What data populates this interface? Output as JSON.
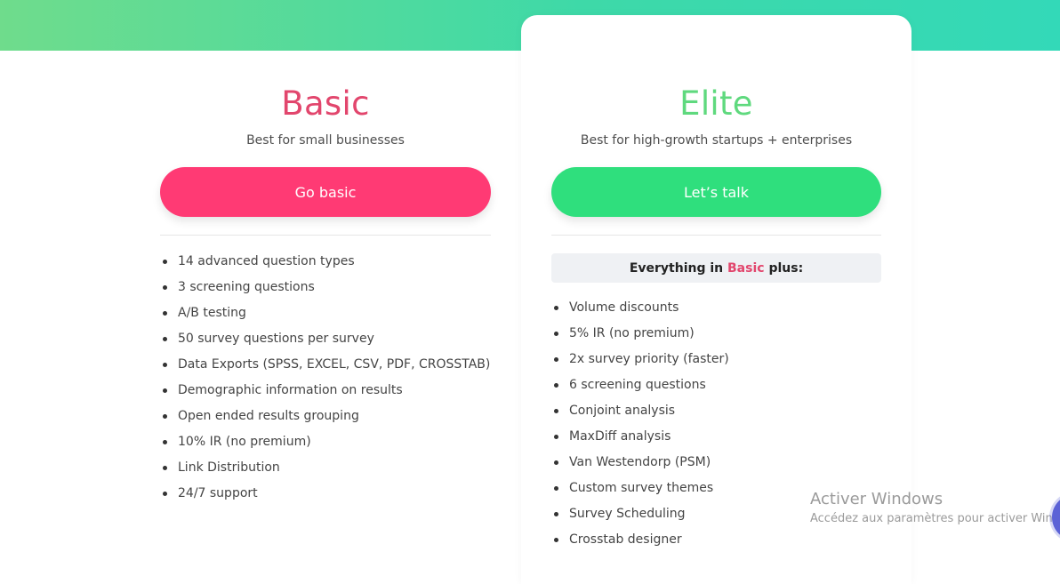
{
  "plans": {
    "basic": {
      "title": "Basic",
      "subtitle": "Best for small businesses",
      "cta": "Go basic",
      "features": [
        "14 advanced question types",
        "3 screening questions",
        "A/B testing",
        "50 survey questions per survey",
        "Data Exports (SPSS, EXCEL, CSV, PDF, CROSSTAB)",
        "Demographic information on results",
        "Open ended results grouping",
        "10% IR (no premium)",
        "Link Distribution",
        "24/7 support"
      ]
    },
    "elite": {
      "title": "Elite",
      "subtitle": "Best for high-growth startups + enterprises",
      "cta": "Let’s talk",
      "includes_prefix": "Everything in",
      "includes_plan": "Basic",
      "includes_suffix": "plus:",
      "features": [
        "Volume discounts",
        "5% IR (no premium)",
        "2x survey priority (faster)",
        "6 screening questions",
        "Conjoint analysis",
        "MaxDiff analysis",
        "Van Westendorp (PSM)",
        "Custom survey themes",
        "Survey Scheduling",
        "Crosstab designer"
      ]
    }
  },
  "watermark": {
    "title": "Activer Windows",
    "subtitle": "Accédez aux paramètres pour activer Windows."
  },
  "colors": {
    "basic_accent": "#e2466d",
    "basic_button": "#ff3a74",
    "elite_accent": "#5fd97e",
    "elite_button": "#2fdf7d",
    "band_start": "#6fdc8c",
    "band_end": "#33d9b8"
  }
}
